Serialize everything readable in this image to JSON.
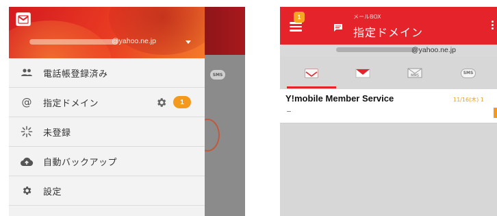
{
  "left_screen": {
    "drawer": {
      "account_domain": "@yahoo.ne.jp",
      "items": [
        {
          "label": "電話帳登録済み",
          "icon": "contacts-icon"
        },
        {
          "label": "指定ドメイン",
          "icon": "at-sign-icon",
          "badge": "1",
          "settings_icon": "gear-icon"
        },
        {
          "label": "未登録",
          "icon": "sparkle-icon"
        },
        {
          "label": "自動バックアップ",
          "icon": "cloud-upload-icon"
        },
        {
          "label": "設定",
          "icon": "gear-icon"
        }
      ]
    },
    "background": {
      "sms_label": "SMS"
    }
  },
  "right_screen": {
    "toolbar": {
      "subtitle": "メールBOX",
      "title": "指定ドメイン",
      "menu_badge": "1"
    },
    "account_domain": "@yahoo.ne.jp",
    "tabs": [
      {
        "icon": "ymobile-mail-icon",
        "active": true
      },
      {
        "icon": "mms-red-icon",
        "active": false
      },
      {
        "icon": "mms-envelope-icon",
        "label": "MMS",
        "active": false
      },
      {
        "icon": "sms-bubble-icon",
        "label": "SMS",
        "active": false
      }
    ],
    "messages": [
      {
        "sender": "Y!mobile Member Service",
        "date": "11/16(木) 1",
        "preview": "…"
      }
    ]
  },
  "colors": {
    "brand_red": "#e5232a",
    "badge_orange": "#f39a1e",
    "drawer_bg": "#f3f3f3"
  }
}
